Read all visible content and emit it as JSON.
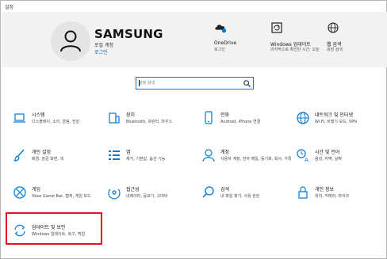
{
  "window": {
    "title": "설정"
  },
  "account": {
    "name": "SAMSUNG",
    "type": "로컬 계정",
    "link": "로그인"
  },
  "quick_actions": [
    {
      "title": "OneDrive",
      "subtitle": "로그인",
      "icon": "cloud-icon"
    },
    {
      "title": "Windows 업데이트",
      "subtitle": "마지막으로 확인한 시간: 오늘",
      "icon": "refresh-icon"
    },
    {
      "title": "웹 검색",
      "subtitle": "",
      "icon": "globe-icon"
    }
  ],
  "search": {
    "placeholder": "설정 검색"
  },
  "categories": [
    {
      "title": "시스템",
      "desc": "디스플레이, 소리, 알림, 전원",
      "icon": "laptop-icon"
    },
    {
      "title": "장치",
      "desc": "Bluetooth, 프린터, 마우스",
      "icon": "devices-icon"
    },
    {
      "title": "전화",
      "desc": "Android, iPhone 연결",
      "icon": "phone-icon"
    },
    {
      "title": "네트워크 및 인터넷",
      "desc": "Wi-Fi, 비행기 모드, VPN",
      "icon": "globe-icon"
    },
    {
      "title": "개인 설정",
      "desc": "배경, 잠금 화면, 색",
      "icon": "brush-icon"
    },
    {
      "title": "앱",
      "desc": "제거, 기본값, 옵션 기능",
      "icon": "apps-icon"
    },
    {
      "title": "계정",
      "desc": "사용자 계정, 전자 메일, 동기화, 회사, 가족",
      "icon": "person-icon"
    },
    {
      "title": "시간 및 언어",
      "desc": "음성, 지역, 날짜",
      "icon": "time-language-icon"
    },
    {
      "title": "게임",
      "desc": "Xbox Game Bar, 캡처, 게임 모드",
      "icon": "xbox-icon"
    },
    {
      "title": "접근성",
      "desc": "내레이터, 돋보기, 고대비",
      "icon": "ease-of-access-icon"
    },
    {
      "title": "검색",
      "desc": "내 파일 찾기, 사용 권한",
      "icon": "search-icon"
    },
    {
      "title": "개인 정보",
      "desc": "위치, 카메라, 마이크",
      "icon": "lock-icon"
    },
    {
      "title": "업데이트 및 보안",
      "desc": "Windows 업데이트, 복구, 백업",
      "icon": "sync-icon"
    }
  ],
  "colors": {
    "accent": "#0078d7",
    "highlight": "#e81123",
    "header_bg": "#f2f2f2"
  }
}
